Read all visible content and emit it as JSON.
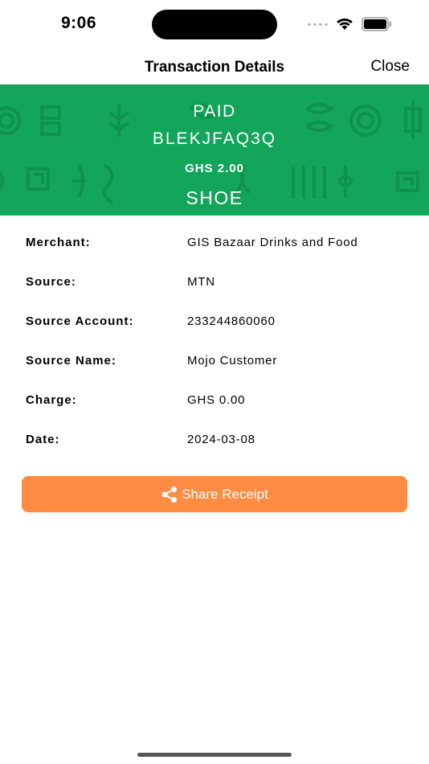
{
  "status_bar": {
    "time": "9:06"
  },
  "nav": {
    "title": "Transaction Details",
    "close_label": "Close"
  },
  "banner": {
    "status": "PAID",
    "reference": "BLEKJFAQ3Q",
    "amount": "GHS 2.00",
    "description": "SHOE",
    "background_color": "#13a55a"
  },
  "details": [
    {
      "label": "Merchant:",
      "value": "GIS Bazaar Drinks and Food"
    },
    {
      "label": "Source:",
      "value": "MTN"
    },
    {
      "label": "Source Account:",
      "value": "233244860060"
    },
    {
      "label": "Source Name:",
      "value": "Mojo Customer"
    },
    {
      "label": "Charge:",
      "value": "GHS 0.00"
    },
    {
      "label": "Date:",
      "value": "2024-03-08"
    }
  ],
  "share_button": {
    "label": "Share Receipt",
    "icon": "share-icon",
    "color": "#ff8c42"
  }
}
